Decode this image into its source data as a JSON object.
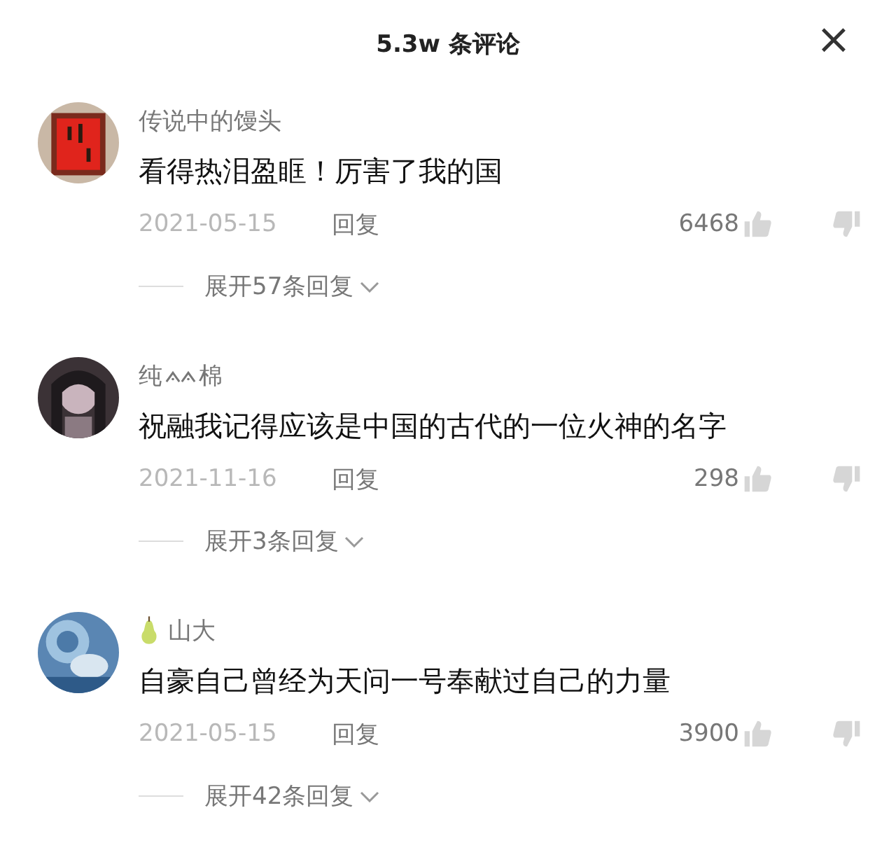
{
  "header": {
    "title": "5.3w 条评论",
    "close": "×"
  },
  "comments": [
    {
      "name": [
        {
          "kind": "text",
          "text": "传说中的馒头"
        }
      ],
      "text": "看得热泪盈眶！厉害了我的国",
      "date": "2021-05-15",
      "reply": "回复",
      "likes": "6468",
      "expand": "展开57条回复"
    },
    {
      "name": [
        {
          "kind": "text",
          "text": "纯"
        },
        {
          "kind": "symbol"
        },
        {
          "kind": "text",
          "text": "棉"
        }
      ],
      "text": "祝融我记得应该是中国的古代的一位火神的名字",
      "date": "2021-11-16",
      "reply": "回复",
      "likes": "298",
      "expand": "展开3条回复"
    },
    {
      "name": [
        {
          "kind": "emoji"
        },
        {
          "kind": "text",
          "text": "山大"
        }
      ],
      "text": "自豪自己曾经为天问一号奉献过自己的力量",
      "date": "2021-05-15",
      "reply": "回复",
      "likes": "3900",
      "expand": "展开42条回复"
    }
  ]
}
